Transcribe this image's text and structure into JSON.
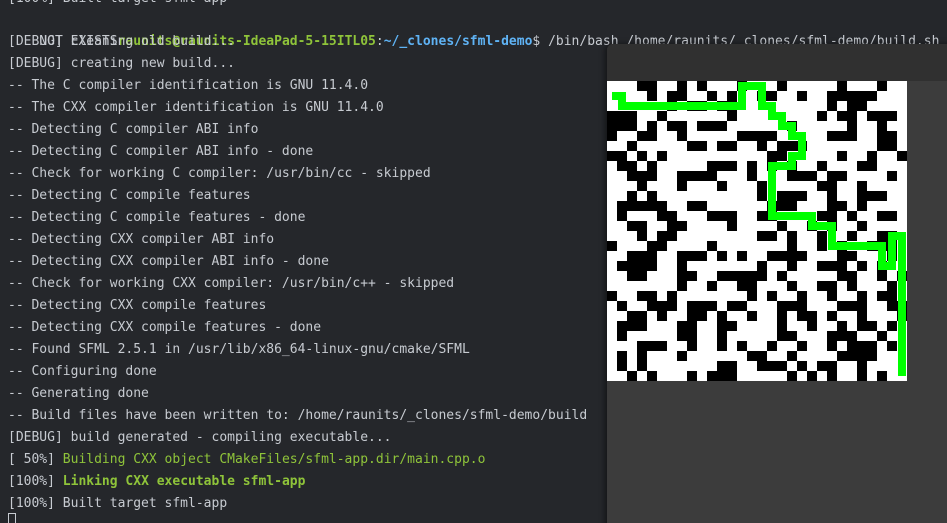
{
  "terminal": {
    "top_partial": "[100%] Built target sfml-app",
    "prompt": {
      "prefix": "NOT EXISTS",
      "userhost": "raunits@raunits-IdeaPad-5-15ITL05",
      "sep": ":",
      "path": "~/_clones/sfml-demo",
      "symbol": "$ ",
      "command": "/bin/bash /home/raunits/_clones/sfml-demo/build.sh"
    },
    "lines": [
      {
        "t": "[DEBUG] cleaning old build..."
      },
      {
        "t": "[DEBUG] creating new build..."
      },
      {
        "t": "-- The C compiler identification is GNU 11.4.0"
      },
      {
        "t": "-- The CXX compiler identification is GNU 11.4.0"
      },
      {
        "t": "-- Detecting C compiler ABI info"
      },
      {
        "t": "-- Detecting C compiler ABI info - done"
      },
      {
        "t": "-- Check for working C compiler: /usr/bin/cc - skipped"
      },
      {
        "t": "-- Detecting C compile features"
      },
      {
        "t": "-- Detecting C compile features - done"
      },
      {
        "t": "-- Detecting CXX compiler ABI info"
      },
      {
        "t": "-- Detecting CXX compiler ABI info - done"
      },
      {
        "t": "-- Check for working CXX compiler: /usr/bin/c++ - skipped"
      },
      {
        "t": "-- Detecting CXX compile features"
      },
      {
        "t": "-- Detecting CXX compile features - done"
      },
      {
        "t": "-- Found SFML 2.5.1 in /usr/lib/x86_64-linux-gnu/cmake/SFML"
      },
      {
        "t": "-- Configuring done"
      },
      {
        "t": "-- Generating done"
      },
      {
        "t": "-- Build files have been written to: /home/raunits/_clones/sfml-demo/build"
      },
      {
        "t": "[DEBUG] build generated - compiling executable..."
      },
      {
        "p": "[ 50%] ",
        "t": "Building CXX object CMakeFiles/sfml-app.dir/main.cpp.o",
        "style": "green"
      },
      {
        "p": "[100%] ",
        "t": "Linking CXX executable sfml-app",
        "style": "greenbold"
      },
      {
        "t": "[100%] Built target sfml-app"
      }
    ]
  },
  "colors": {
    "terminal_bg": "#25272b",
    "text": "#c7cbd1",
    "prompt_green": "#8fc43a",
    "prompt_blue": "#5fb3f5",
    "maze_wall": "#000000",
    "maze_open": "#ffffff",
    "maze_path": "#00ff00"
  },
  "sfml_window": {
    "maze_cols": 30,
    "maze_rows": 30,
    "maze_rows_data": [
      "...##..#.#...#...#.....#...#..",
      "....#.##..#.#..##..#..#####...",
      "......#.##.##.........#.##....",
      "###..#......#........#.##.###.",
      "###.#.##.###......#.....#..#..",
      "#..##..#.....####.....###..##.",
      "..#.....##.##..#.###.......##.",
      "##.#.#..........##.....#..#..#",
      ".##.#.....###.#.#.#..#...##...",
      "..###..####...#...###.##....#.",
      "...#...#...#...#.....##..#....",
      "..#.#..........#.###..#..###..",
      ".#####..##......###...##.#....",
      ".#...##...###..##....##.#..##.",
      "..##..##....#....#..#.#..#....",
      "...#.##........##.#..#..#..##.",
      "#...##....#.......#..#.#..###.",
      "..###..###.#.#..####...##...#.",
      ".####..#.......#..#..###.#.#..",
      "..##...##..#####.#.....##..#.#",
      ".......#..#..##...#..##.#...#.",
      "#..##.#.......#.#..#..#..#.##.",
      ".#..###.###.##...###...###..##",
      "..##.#..##.#..#..#.##.#..#...#",
      ".###...##..##....#..#..#.##.#.",
      ".#.....##..#.....##...###..#..",
      "...###..#..#.#..#..#..#.###.#.",
      ".#.#...#......##..#....####...",
      ".#.#.......##..###.#.##..#....",
      "..#.#...#.###.....#.#.#..#.#.."
    ],
    "maze_path": [
      [
        0,
        1
      ],
      [
        1,
        1
      ],
      [
        1,
        2
      ],
      [
        2,
        2
      ],
      [
        3,
        2
      ],
      [
        4,
        2
      ],
      [
        5,
        2
      ],
      [
        6,
        2
      ],
      [
        7,
        2
      ],
      [
        8,
        2
      ],
      [
        9,
        2
      ],
      [
        10,
        2
      ],
      [
        11,
        2
      ],
      [
        12,
        2
      ],
      [
        13,
        2
      ],
      [
        13,
        1
      ],
      [
        13,
        0
      ],
      [
        14,
        0
      ],
      [
        15,
        0
      ],
      [
        15,
        1
      ],
      [
        15,
        2
      ],
      [
        16,
        2
      ],
      [
        16,
        3
      ],
      [
        17,
        3
      ],
      [
        17,
        4
      ],
      [
        18,
        4
      ],
      [
        18,
        5
      ],
      [
        19,
        5
      ],
      [
        19,
        6
      ],
      [
        19,
        7
      ],
      [
        18,
        7
      ],
      [
        18,
        8
      ],
      [
        17,
        8
      ],
      [
        16,
        8
      ],
      [
        16,
        9
      ],
      [
        16,
        10
      ],
      [
        16,
        11
      ],
      [
        16,
        12
      ],
      [
        16,
        13
      ],
      [
        17,
        13
      ],
      [
        18,
        13
      ],
      [
        19,
        13
      ],
      [
        20,
        13
      ],
      [
        20,
        14
      ],
      [
        21,
        14
      ],
      [
        22,
        14
      ],
      [
        22,
        15
      ],
      [
        22,
        16
      ],
      [
        23,
        16
      ],
      [
        24,
        16
      ],
      [
        25,
        16
      ],
      [
        26,
        16
      ],
      [
        27,
        16
      ],
      [
        27,
        17
      ],
      [
        27,
        18
      ],
      [
        28,
        18
      ],
      [
        28,
        17
      ],
      [
        28,
        16
      ],
      [
        28,
        15
      ],
      [
        29,
        15
      ],
      [
        29,
        16
      ],
      [
        29,
        17
      ],
      [
        29,
        18
      ],
      [
        29,
        19
      ],
      [
        29,
        20
      ],
      [
        29,
        21
      ],
      [
        29,
        22
      ],
      [
        29,
        23
      ],
      [
        29,
        24
      ],
      [
        29,
        25
      ],
      [
        29,
        26
      ],
      [
        29,
        27
      ],
      [
        29,
        28
      ],
      [
        29,
        29
      ]
    ]
  }
}
